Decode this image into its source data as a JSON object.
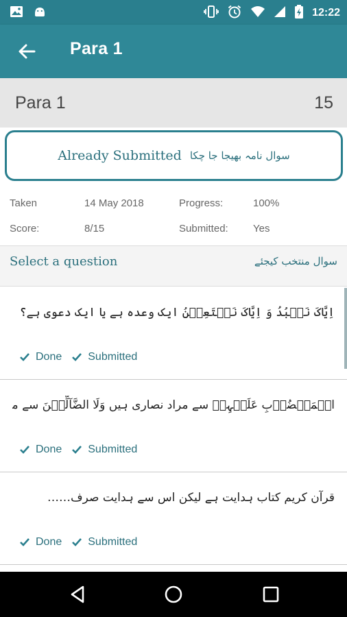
{
  "status_bar": {
    "time": "12:22",
    "icons": [
      "image-icon",
      "android-icon",
      "vibrate-icon",
      "alarm-icon",
      "wifi-icon",
      "signal-icon",
      "battery-icon"
    ]
  },
  "app_bar": {
    "title": "Para 1",
    "back_icon": "arrow-left-icon"
  },
  "para_header": {
    "name": "Para 1",
    "count": "15"
  },
  "submission": {
    "text_en": "Already Submitted",
    "text_ur": "سوال نامہ بھیجا جا چکا",
    "border_color": "#2a7f8e"
  },
  "info": {
    "taken_label": "Taken",
    "taken_value": "14 May 2018",
    "progress_label": "Progress:",
    "progress_value": "100%",
    "score_label": "Score:",
    "score_value": "8/15",
    "submitted_label": "Submitted:",
    "submitted_value": "Yes"
  },
  "select": {
    "label_en": "Select a question",
    "label_ur": "سوال منتخب کیجئے"
  },
  "questions": [
    {
      "text": "اِیَّاکَ نَعۡبُدُ وَ اِیَّاکَ نَسۡتَعِیۡنُ ایک وعدہ ہے یا ایک دعوی ہے؟",
      "done": "Done",
      "submitted": "Submitted"
    },
    {
      "text": "الۡمَغۡضُوۡبِ عَلَیۡہِمۡ سے مراد نصاری ہیں وَلَا الضَّآلِّیۡنَ سے مراد یہود…",
      "done": "Done",
      "submitted": "Submitted"
    },
    {
      "text": "قرآن کریم کتاب ہدایت ہے لیکن اس سے ہدایت صرف……",
      "done": "Done",
      "submitted": "Submitted"
    }
  ],
  "nav": {
    "back": "nav-back-icon",
    "home": "nav-home-icon",
    "recents": "nav-recents-icon"
  },
  "colors": {
    "primary": "#2f8897",
    "status_bar": "#2a7f8e",
    "accent_text": "#2a6f7c"
  }
}
